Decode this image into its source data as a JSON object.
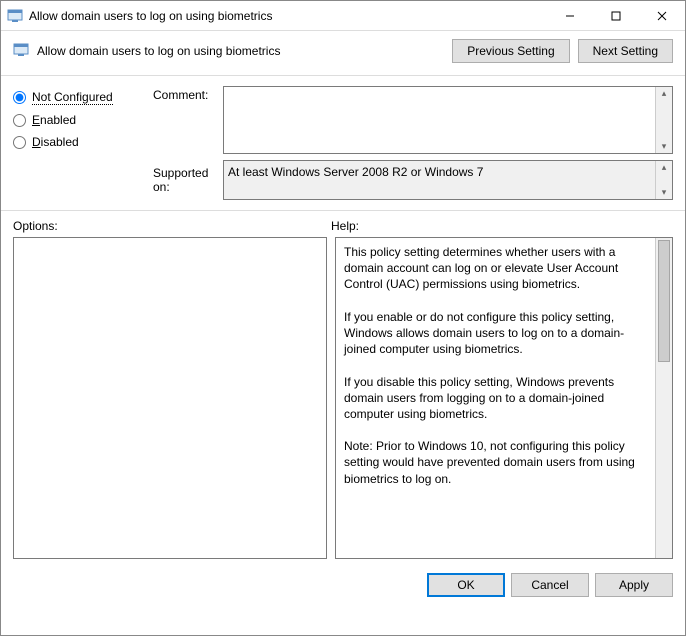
{
  "window": {
    "title": "Allow domain users to log on using biometrics"
  },
  "header": {
    "policy_title": "Allow domain users to log on using biometrics",
    "prev_btn": "Previous Setting",
    "next_btn": "Next Setting"
  },
  "state": {
    "radios": {
      "not_configured": "Not Configured",
      "enabled": "Enabled",
      "disabled": "Disabled",
      "selected": "not_configured"
    },
    "comment_label": "Comment:",
    "comment_value": "",
    "supported_label": "Supported on:",
    "supported_value": "At least Windows Server 2008 R2 or Windows 7"
  },
  "panels": {
    "options_label": "Options:",
    "help_label": "Help:",
    "help_text": "This policy setting determines whether users with a domain account can log on or elevate User Account Control (UAC) permissions using biometrics.\n\nIf you enable or do not configure this policy setting, Windows allows domain users to log on to a domain-joined computer using biometrics.\n\nIf you disable this policy setting, Windows prevents domain users from logging on to a domain-joined computer using biometrics.\n\nNote: Prior to Windows 10, not configuring this policy setting would have prevented domain users from using biometrics to log on."
  },
  "footer": {
    "ok": "OK",
    "cancel": "Cancel",
    "apply": "Apply"
  }
}
